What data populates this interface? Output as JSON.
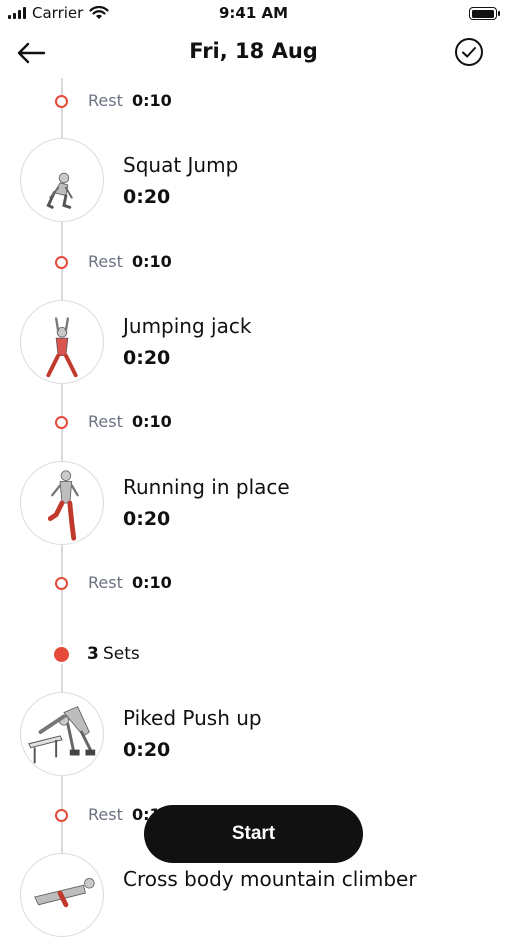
{
  "status_bar": {
    "carrier": "Carrier",
    "time": "9:41 AM"
  },
  "header": {
    "title": "Fri, 18 Aug"
  },
  "rest_label": "Rest",
  "items": [
    {
      "type": "rest",
      "duration": "0:10"
    },
    {
      "type": "exercise",
      "name": "Squat Jump",
      "duration": "0:20",
      "image_icon": "squat-jump-figure"
    },
    {
      "type": "rest",
      "duration": "0:10"
    },
    {
      "type": "exercise",
      "name": "Jumping jack",
      "duration": "0:20",
      "image_icon": "jumping-jack-figure"
    },
    {
      "type": "rest",
      "duration": "0:10"
    },
    {
      "type": "exercise",
      "name": "Running in place",
      "duration": "0:20",
      "image_icon": "running-figure"
    },
    {
      "type": "rest",
      "duration": "0:10"
    },
    {
      "type": "sets",
      "count": "3",
      "label": "Sets"
    },
    {
      "type": "exercise",
      "name": "Piked Push up",
      "duration": "0:20",
      "image_icon": "pushup-figure"
    },
    {
      "type": "rest",
      "duration": "0:10"
    },
    {
      "type": "exercise",
      "name": "Cross body mountain climber",
      "duration": "",
      "image_icon": "mountain-climber-figure"
    }
  ],
  "start_button": {
    "label": "Start"
  },
  "colors": {
    "accent": "#e64a3b",
    "text": "#111111",
    "muted": "#6b7280",
    "line": "#d9d9d9"
  }
}
